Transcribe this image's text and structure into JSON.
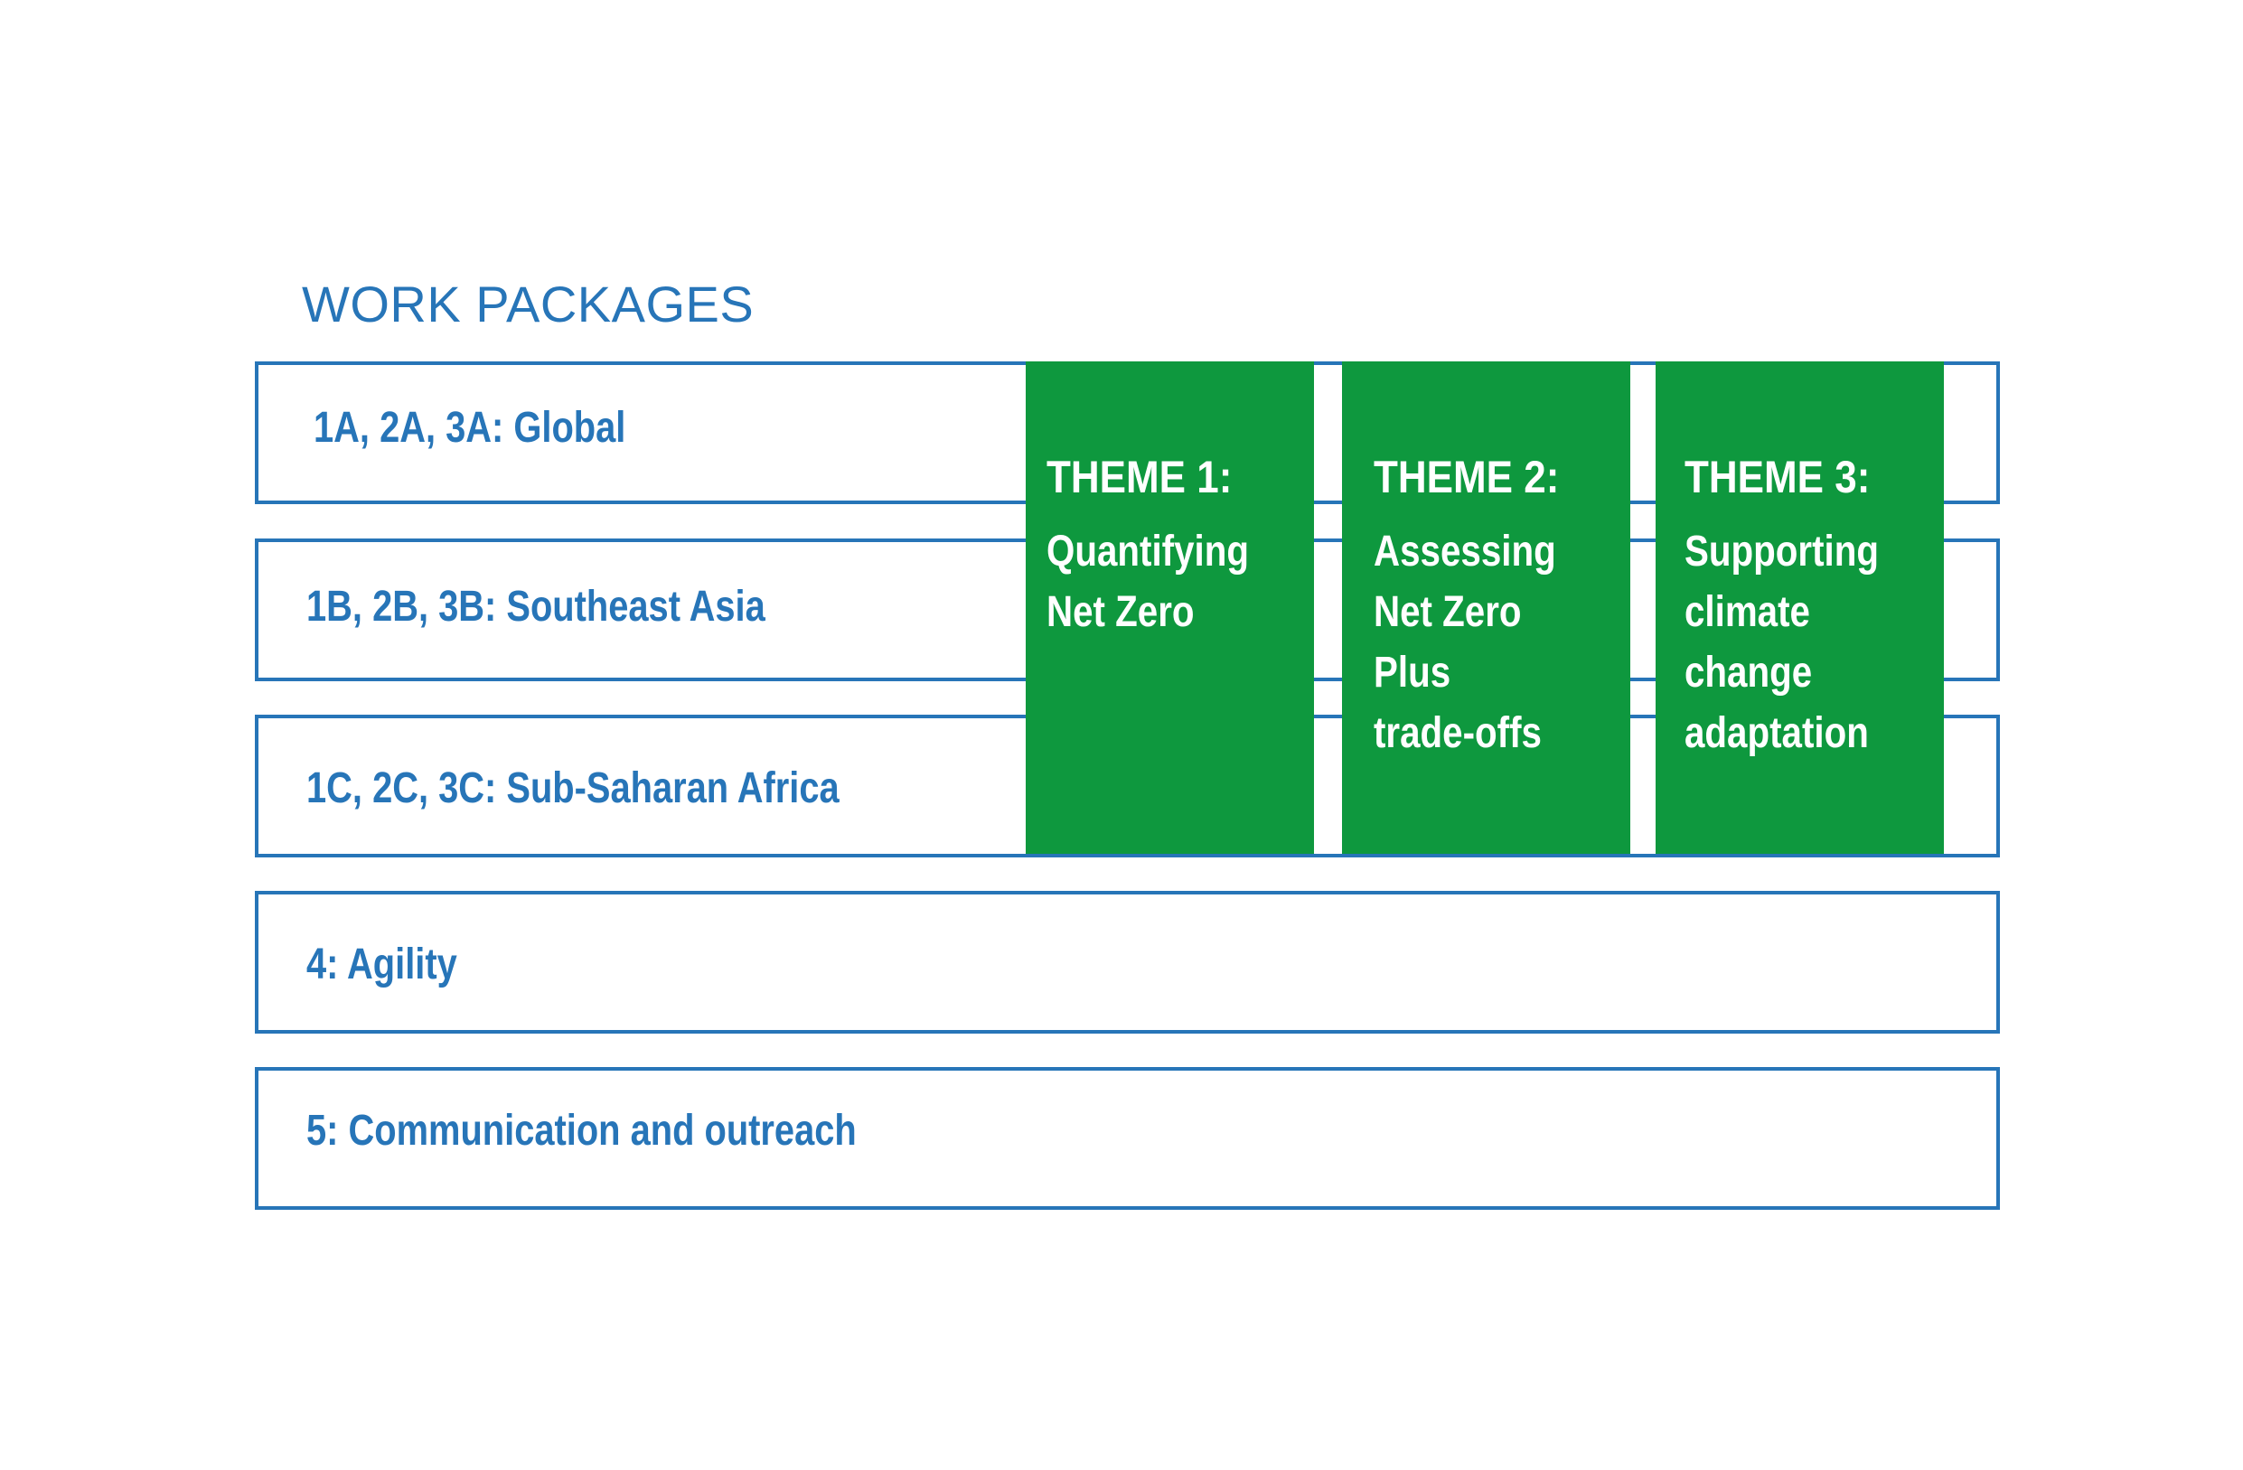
{
  "heading": "WORK PACKAGES",
  "colors": {
    "primary_blue": "#2775b8",
    "theme_green": "#0e983e",
    "background": "#ffffff"
  },
  "work_packages": [
    {
      "label": "1A, 2A, 3A: Global"
    },
    {
      "label": "1B, 2B, 3B: Southeast Asia"
    },
    {
      "label": "1C, 2C, 3C: Sub-Saharan Africa"
    },
    {
      "label": "4: Agility"
    },
    {
      "label": "5: Communication and outreach"
    }
  ],
  "themes": [
    {
      "title": "THEME 1:",
      "lines": [
        "Quantifying",
        "Net Zero"
      ]
    },
    {
      "title": "THEME 2:",
      "lines": [
        "Assessing",
        "Net Zero",
        "Plus",
        "trade-offs"
      ]
    },
    {
      "title": "THEME 3:",
      "lines": [
        "Supporting",
        "climate",
        "change",
        "adaptation"
      ]
    }
  ]
}
